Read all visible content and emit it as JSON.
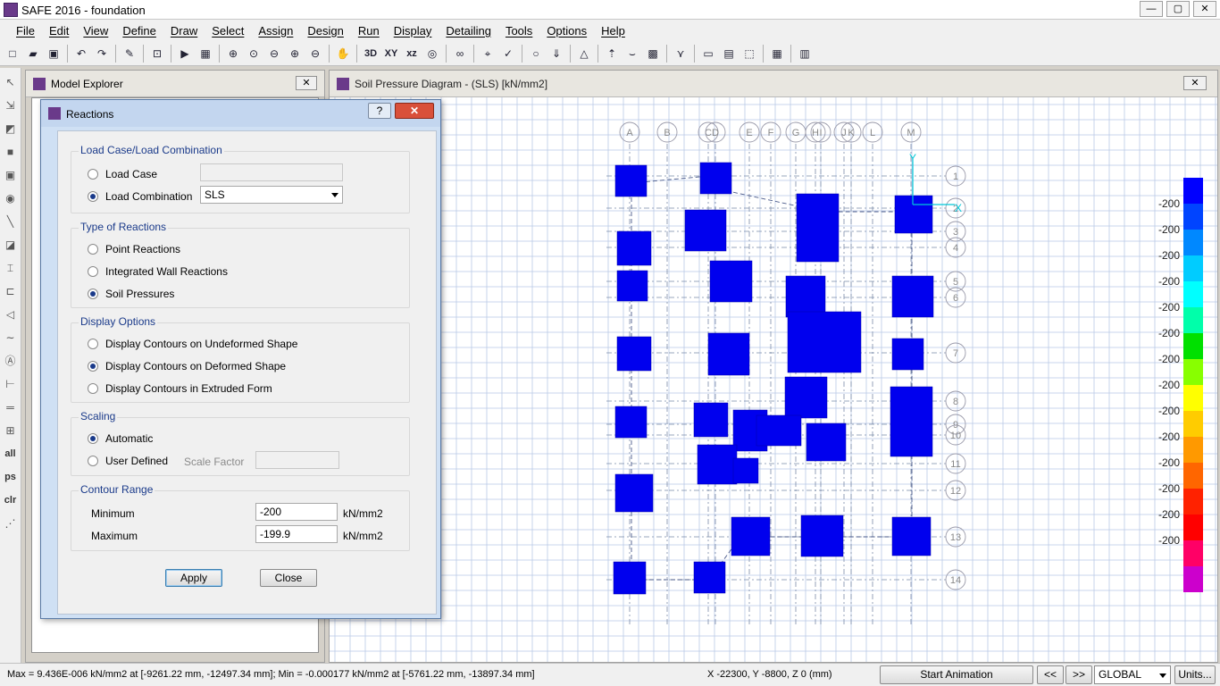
{
  "window": {
    "title": "SAFE 2016 - foundation",
    "min": "—",
    "max": "▢",
    "close": "✕"
  },
  "menu": [
    "File",
    "Edit",
    "View",
    "Define",
    "Draw",
    "Select",
    "Assign",
    "Design",
    "Run",
    "Display",
    "Detailing",
    "Tools",
    "Options",
    "Help"
  ],
  "toolbar": {
    "view_3d": "3D",
    "view_xy": "XY",
    "view_xz": "xz"
  },
  "lefttools": {
    "all": "all",
    "ps": "ps",
    "clr": "clr"
  },
  "explorer": {
    "title": "Model Explorer",
    "close": "✕"
  },
  "canvas": {
    "title": "Soil Pressure Diagram - (SLS)  [kN/mm2]",
    "close": "✕",
    "grid_cols": [
      "A",
      "B",
      "C",
      "D",
      "E",
      "F",
      "G",
      "H",
      "I",
      "J",
      "K",
      "L",
      "M"
    ],
    "grid_rows": [
      "1",
      "2",
      "3",
      "4",
      "5",
      "6",
      "7",
      "8",
      "9",
      "10",
      "11",
      "12",
      "13",
      "14"
    ],
    "legend_values": [
      "-200",
      "-200",
      "-200",
      "-200",
      "-200",
      "-200",
      "-200",
      "-200",
      "-200",
      "-200",
      "-200",
      "-200",
      "-200",
      "-200"
    ],
    "legend_colors": [
      "#0000ff",
      "#0044ff",
      "#0088ff",
      "#00ccff",
      "#00ffff",
      "#00ffaa",
      "#00e000",
      "#88ff00",
      "#ffff00",
      "#ffcc00",
      "#ff9900",
      "#ff6600",
      "#ff2200",
      "#ff0000",
      "#ff0066",
      "#cc00cc"
    ],
    "pad_color": "#0000ee",
    "axis_x": "X",
    "axis_y": "Y"
  },
  "dialog": {
    "title": "Reactions",
    "help": "?",
    "close": "✕",
    "load_group": "Load Case/Load Combination",
    "load_case": "Load Case",
    "load_combo": "Load Combination",
    "combo_value": "SLS",
    "type_group": "Type of Reactions",
    "point": "Point Reactions",
    "wall": "Integrated Wall Reactions",
    "soil": "Soil Pressures",
    "display_group": "Display Options",
    "undeformed": "Display Contours on Undeformed Shape",
    "deformed": "Display Contours on Deformed Shape",
    "extruded": "Display Contours in Extruded Form",
    "scaling_group": "Scaling",
    "automatic": "Automatic",
    "user_defined": "User Defined",
    "scale_factor": "Scale Factor",
    "contour_group": "Contour Range",
    "minimum": "Minimum",
    "maximum": "Maximum",
    "min_value": "-200",
    "max_value": "-199.9",
    "unit": "kN/mm2",
    "apply": "Apply",
    "close_btn": "Close"
  },
  "status": {
    "text": "Max = 9.436E-006 kN/mm2 at [-9261.22 mm, -12497.34 mm];  Min = -0.000177 kN/mm2 at [-5761.22 mm, -13897.34 mm]",
    "coords": "X -22300,  Y -8800,  Z 0  (mm)",
    "start_animation": "Start Animation",
    "prev": "<<",
    "next": ">>",
    "coord_system": "GLOBAL",
    "units": "Units..."
  }
}
